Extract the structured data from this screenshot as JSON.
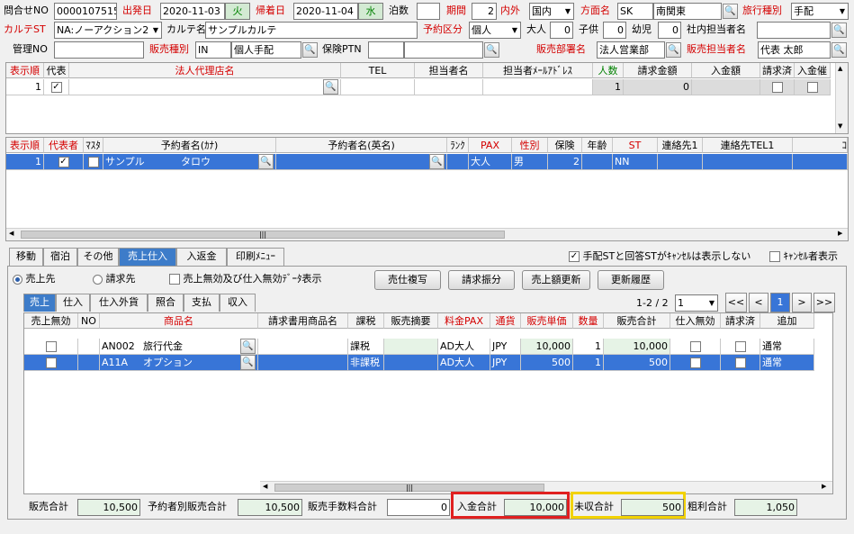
{
  "header": {
    "inquiry_no_label": "問合せNO",
    "inquiry_no": "0000107515",
    "depart_label": "出発日",
    "depart_date": "2020-11-03",
    "depart_day": "火",
    "return_label": "帰着日",
    "return_date": "2020-11-04",
    "return_day": "水",
    "nights_label": "泊数",
    "nights": "",
    "period_label": "期間",
    "period": "2",
    "domestic_label": "内外",
    "domestic": "国内",
    "direction_label": "方面名",
    "direction_code": "SK",
    "direction_name": "南関東",
    "travel_type_label": "旅行種別",
    "travel_type": "手配",
    "karte_st_label": "カルテST",
    "karte_st": "NA:ノーアクション2",
    "karte_name_label": "カルテ名",
    "karte_name": "サンプルカルテ",
    "booking_type_label": "予約区分",
    "booking_type": "個人",
    "adult_label": "大人",
    "adult": "0",
    "child_label": "子供",
    "child": "0",
    "infant_label": "幼児",
    "infant": "0",
    "staff_label": "社内担当者名",
    "staff": "",
    "manage_no_label": "管理NO",
    "manage_no": "",
    "sales_type_label": "販売種別",
    "sales_type_code": "IN",
    "sales_type_name": "個人手配",
    "insurance_label": "保険PTN",
    "insurance": "",
    "sales_dept_label": "販売部署名",
    "sales_dept": "法人営業部",
    "sales_staff_label": "販売担当者名",
    "sales_staff": "代表 太郎"
  },
  "agent_table": {
    "columns": [
      "表示順",
      "代表",
      "法人代理店名",
      "TEL",
      "担当者名",
      "担当者ﾒｰﾙｱﾄﾞﾚｽ",
      "人数",
      "請求金額",
      "入金額",
      "請求済",
      "入金催"
    ],
    "row": {
      "order": "1",
      "count": "1",
      "billed": "0"
    }
  },
  "booker_table": {
    "columns": [
      "表示順",
      "代表者",
      "ﾏｽﾀ",
      "予約者名(ｶﾅ)",
      "予約者名(英名)",
      "ﾗﾝｸ",
      "PAX",
      "性別",
      "保険",
      "年齢",
      "ST",
      "連絡先1",
      "連絡先TEL1",
      "ｺ"
    ],
    "row": {
      "order": "1",
      "kana_last": "サンプル",
      "kana_first": "タロウ",
      "pax": "大人",
      "sex": "男",
      "insurance": "2",
      "st": "NN"
    }
  },
  "main_tabs": [
    "移動",
    "宿泊",
    "その他",
    "売上仕入",
    "入返金",
    "印刷ﾒﾆｭｰ"
  ],
  "options": {
    "cancel_hide": "手配STと回答STがｷｬﾝｾﾙは表示しない",
    "cancel_show": "ｷｬﾝｾﾙ者表示"
  },
  "radios": {
    "seller": "売上先",
    "bill_to": "請求先",
    "invalid_show": "売上無効及び仕入無効ﾃﾞｰﾀ表示"
  },
  "actions": {
    "copy": "売仕複写",
    "split": "請求振分",
    "update": "売上額更新",
    "history": "更新履歴"
  },
  "sub_tabs": [
    "売上",
    "仕入",
    "仕入外貨",
    "照合",
    "支払",
    "収入"
  ],
  "pager": {
    "text": "1-2 / 2",
    "page": "1",
    "prev_all": "<<",
    "prev": "<",
    "current": "1",
    "next": ">",
    "next_all": ">>"
  },
  "sales_table": {
    "columns": [
      "売上無効",
      "NO",
      "商品名",
      "請求書用商品名",
      "課税",
      "販売摘要",
      "料金PAX",
      "通貨",
      "販売単価",
      "数量",
      "販売合計",
      "仕入無効",
      "請求済",
      "追加"
    ],
    "rows": [
      {
        "code": "AN002",
        "name": "旅行代金",
        "tax": "課税",
        "pax": "AD大人",
        "currency": "JPY",
        "price": "10,000",
        "qty": "1",
        "total": "10,000",
        "extra": "通常"
      },
      {
        "code": "A11A",
        "name": "オプション",
        "tax": "非課税",
        "pax": "AD大人",
        "currency": "JPY",
        "price": "500",
        "qty": "1",
        "total": "500",
        "extra": "通常"
      }
    ]
  },
  "totals": {
    "sales_total_label": "販売合計",
    "sales_total": "10,500",
    "booker_total_label": "予約者別販売合計",
    "booker_total": "10,500",
    "fee_total_label": "販売手数料合計",
    "fee_total": "0",
    "received_label": "入金合計",
    "received": "10,000",
    "unpaid_label": "未収合計",
    "unpaid": "500",
    "profit_label": "粗利合計",
    "profit": "1,050"
  },
  "colors": {
    "highlight_red": "#e02020",
    "highlight_yellow": "#f2d200",
    "selection": "#3875d7"
  }
}
